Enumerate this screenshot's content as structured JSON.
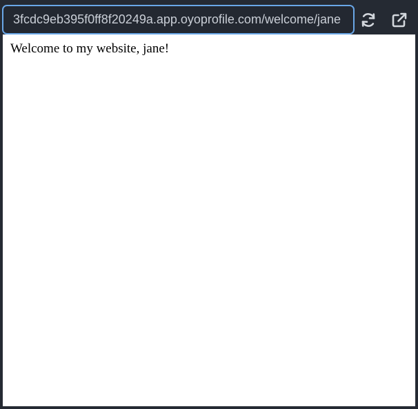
{
  "browser": {
    "url": "3fcdc9eb395f0ff8f20249a.app.oyoprofile.com/welcome/jane",
    "refresh_icon": "refresh-icon",
    "open_external_icon": "external-link-icon"
  },
  "page": {
    "welcome_text": "Welcome to my website, jane!"
  },
  "colors": {
    "chrome_bg": "#252a33",
    "url_border": "#6aa7e8",
    "url_text": "#c9ced6",
    "icon": "#d3d7dd",
    "page_bg": "#ffffff"
  }
}
